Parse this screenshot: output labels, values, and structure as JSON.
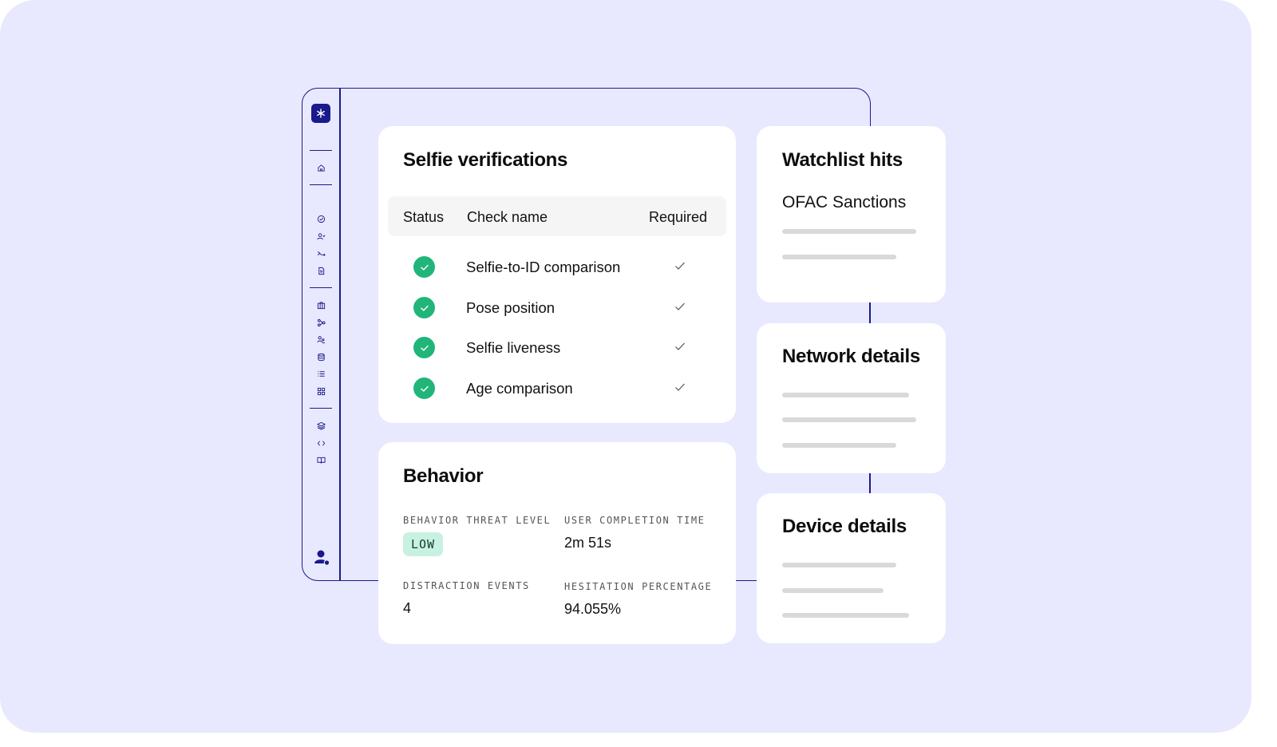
{
  "selfie": {
    "title": "Selfie verifications",
    "columns": {
      "status": "Status",
      "check_name": "Check name",
      "required": "Required"
    },
    "rows": [
      {
        "name": "Selfie-to-ID comparison",
        "status": "passed",
        "required": true
      },
      {
        "name": "Pose position",
        "status": "passed",
        "required": true
      },
      {
        "name": "Selfie liveness",
        "status": "passed",
        "required": true
      },
      {
        "name": "Age comparison",
        "status": "passed",
        "required": true
      }
    ]
  },
  "behavior": {
    "title": "Behavior",
    "threat_label": "BEHAVIOR THREAT LEVEL",
    "threat_value": "LOW",
    "completion_label": "USER COMPLETION TIME",
    "completion_value": "2m 51s",
    "distraction_label": "DISTRACTION EVENTS",
    "distraction_value": "4",
    "hesitation_label": "HESITATION PERCENTAGE",
    "hesitation_value": "94.055%"
  },
  "watchlist": {
    "title": "Watchlist hits",
    "subtitle": "OFAC Sanctions"
  },
  "network": {
    "title": "Network details"
  },
  "device": {
    "title": "Device details"
  },
  "sidebar": {
    "logo_icon": "asterisk-logo-icon",
    "icons": [
      "home-icon",
      "check-circle-icon",
      "user-check-icon",
      "route-icon",
      "document-icon",
      "briefcase-icon",
      "workflow-icon",
      "users-icon",
      "database-icon",
      "list-icon",
      "grid-icon",
      "layers-icon",
      "code-icon",
      "book-icon"
    ],
    "avatar_icon": "user-avatar-icon"
  },
  "colors": {
    "background": "#e8e9fe",
    "accent": "#1a1a8c",
    "success": "#21b57a",
    "badge_bg": "#c9f1e1"
  }
}
